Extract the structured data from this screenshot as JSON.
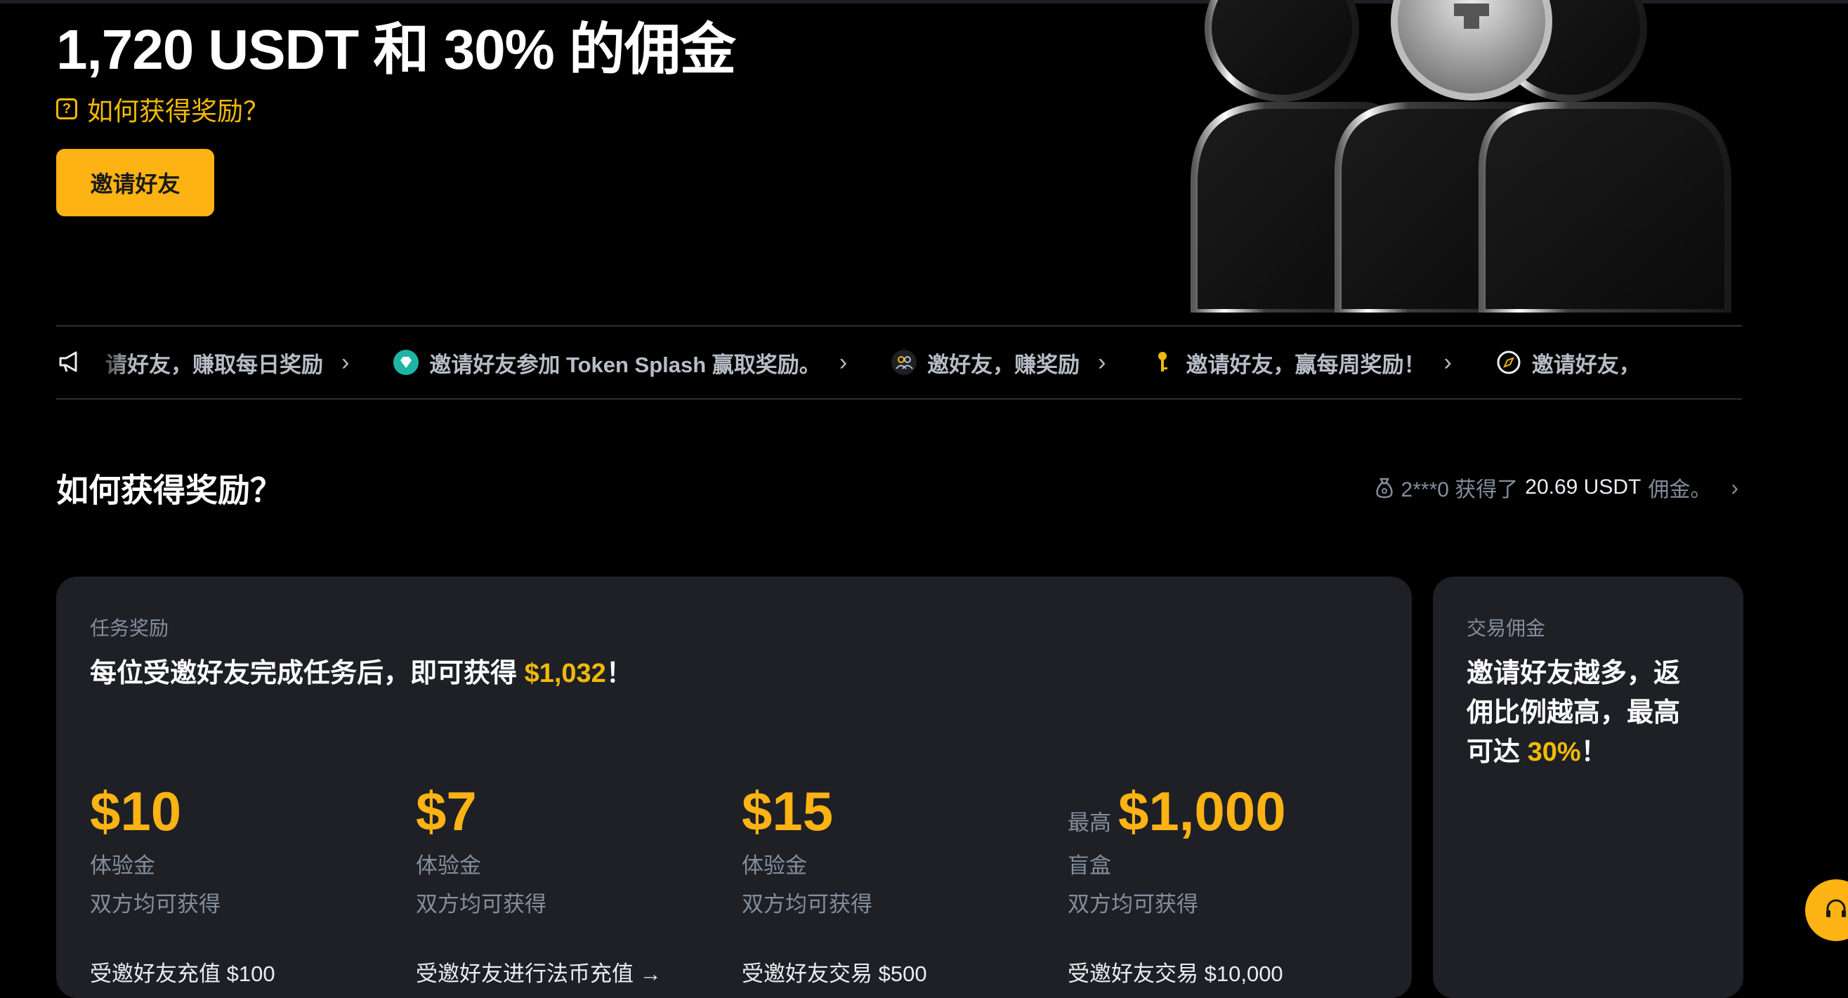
{
  "hero": {
    "title": "1,720 USDT 和 30% 的佣金",
    "how_link": "如何获得奖励？",
    "invite_button": "邀请好友"
  },
  "ticker": {
    "items": [
      {
        "label": "请好友，赚取每日奖励",
        "icon": "gift-icon"
      },
      {
        "label": "邀请好友参加 Token Splash 赢取奖励。",
        "icon": "diamond-icon"
      },
      {
        "label": "邀好友，赚奖励",
        "icon": "users-icon"
      },
      {
        "label": "邀请好友，赢每周奖励！",
        "icon": "key-icon"
      },
      {
        "label": "邀请好友，",
        "icon": "compass-icon"
      }
    ]
  },
  "section": {
    "title": "如何获得奖励？",
    "earned_user": "2***0 获得了",
    "earned_amount": "20.69 USDT",
    "earned_suffix": "佣金。"
  },
  "task_card": {
    "label": "任务奖励",
    "headline_pre": "每位受邀好友完成任务后，即可获得",
    "headline_amount": "$1,032",
    "headline_post": "！",
    "rewards": [
      {
        "prefix": "",
        "amount": "$10",
        "type": "体验金",
        "both": "双方均可获得",
        "condition": "受邀好友充值 $100"
      },
      {
        "prefix": "",
        "amount": "$7",
        "type": "体验金",
        "both": "双方均可获得",
        "condition": "受邀好友进行法币充值 →"
      },
      {
        "prefix": "",
        "amount": "$15",
        "type": "体验金",
        "both": "双方均可获得",
        "condition": "受邀好友交易 $500"
      },
      {
        "prefix": "最高",
        "amount": "$1,000",
        "type": "盲盒",
        "both": "双方均可获得",
        "condition": "受邀好友交易 $10,000"
      }
    ]
  },
  "commission_card": {
    "label": "交易佣金",
    "line1": "邀请好友越多，返",
    "line2": "佣比例越高，最高",
    "line3_pre": "可达 ",
    "line3_accent": "30%",
    "line3_post": "！"
  },
  "colors": {
    "accent": "#f0b90b",
    "button": "#fcb313",
    "card_bg": "#1e2026",
    "muted_text": "#848e9c"
  }
}
